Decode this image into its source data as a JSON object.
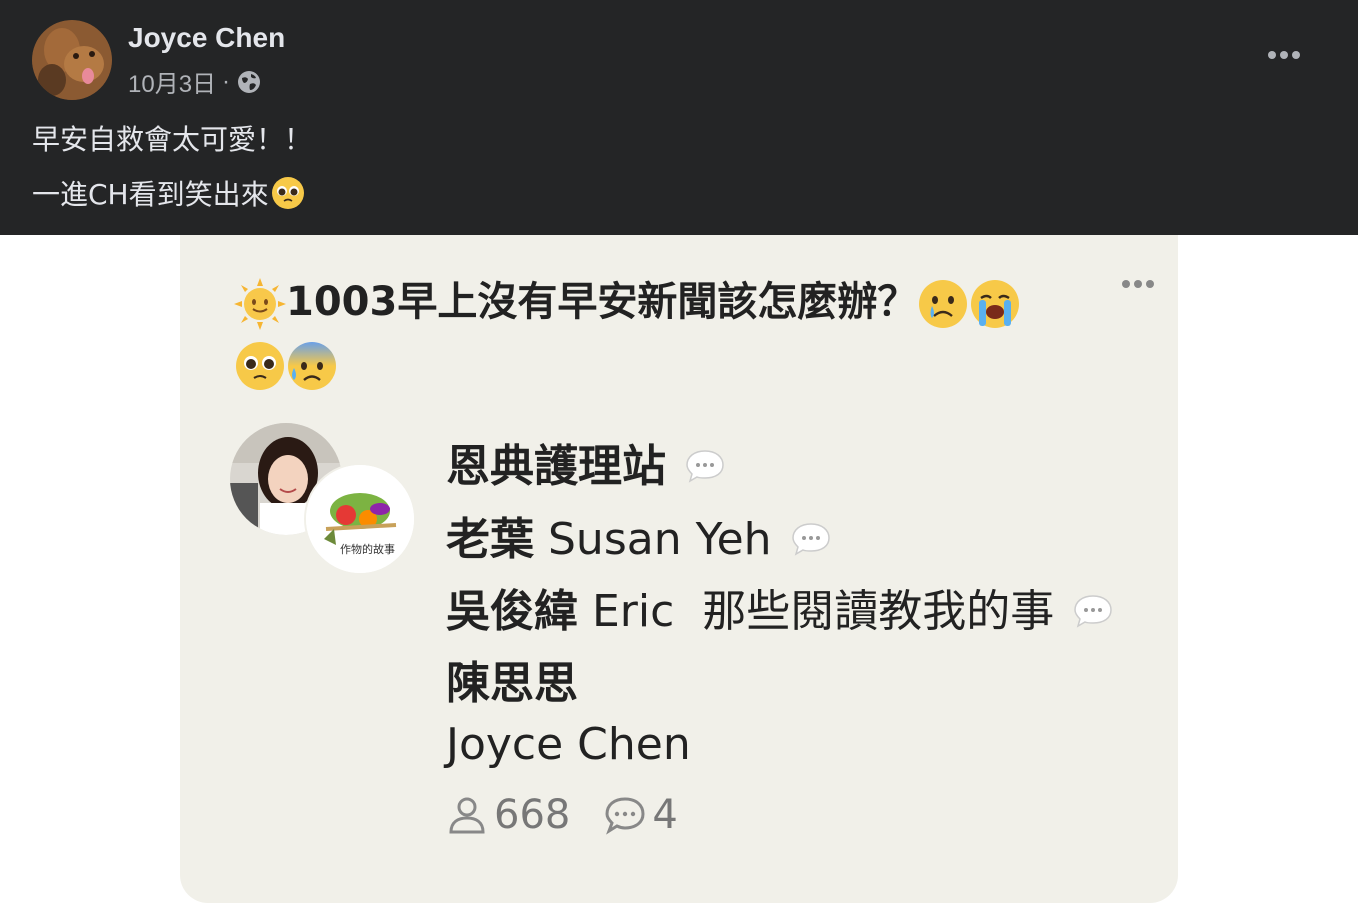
{
  "post": {
    "author": "Joyce Chen",
    "date": "10月3日",
    "separator": "·",
    "visibility_icon": "globe-icon",
    "more_icon": "more-horizontal-icon",
    "text_line1": "早安自救會太可愛！！",
    "text_line2": "一進CH看到笑出來",
    "text_line2_emoji": "pleading-face-emoji"
  },
  "room_card": {
    "title_leading_emoji": "sun-with-face-emoji",
    "title": "1003早上沒有早安新聞該怎麼辦？",
    "title_trailing_emojis": [
      "crying-face-emoji",
      "loudly-crying-face-emoji",
      "pleading-face-emoji",
      "anxious-face-with-sweat-emoji"
    ],
    "more_icon": "more-horizontal-icon",
    "avatar_badge_text": "作物的故事",
    "speakers": [
      {
        "name": "恩典護理站",
        "bold": true,
        "chat_icon": true
      },
      {
        "name_prefix": "老葉",
        "name_rest": "Susan Yeh",
        "chat_icon": true
      },
      {
        "name_prefix": "吳俊緯",
        "name_rest": "Eric  那些閱讀教我的事",
        "chat_icon": true
      },
      {
        "name": "陳思思",
        "bold": true,
        "chat_icon": false
      },
      {
        "name": "Joyce Chen",
        "bold": false,
        "chat_icon": false
      }
    ],
    "listener_count": "668",
    "speaker_count": "4",
    "colors": {
      "header_bg": "#242526",
      "card_bg": "#f1f0e9",
      "text": "#222222",
      "muted": "#777777"
    }
  }
}
